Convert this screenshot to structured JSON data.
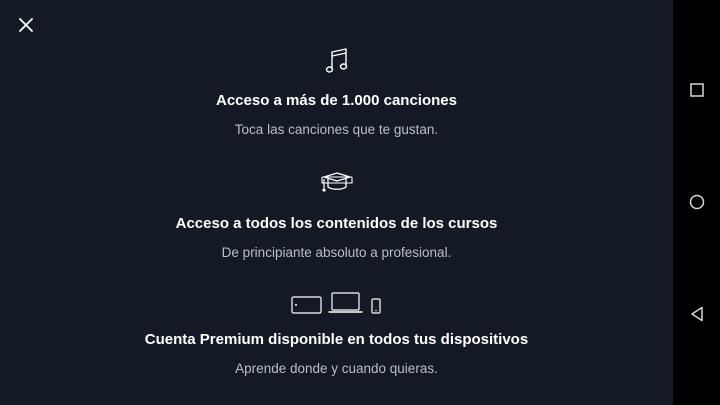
{
  "close": {
    "icon": "close-icon"
  },
  "features": [
    {
      "icon": "music-note-icon",
      "title": "Acceso a más de 1.000 canciones",
      "subtitle": "Toca las canciones que te gustan."
    },
    {
      "icon": "graduation-cap-icon",
      "title": "Acceso a todos los contenidos de los cursos",
      "subtitle": "De principiante absoluto a profesional."
    },
    {
      "icon": "devices-icon",
      "title": "Cuenta Premium disponible en todos tus dispositivos",
      "subtitle": "Aprende donde y cuando quieras."
    }
  ],
  "navbar": {
    "recents": "recents-square-icon",
    "home": "home-circle-icon",
    "back": "back-triangle-icon"
  },
  "colors": {
    "background": "#141a25",
    "title": "#ffffff",
    "subtitle": "#b9bec8",
    "navbar": "#000000"
  }
}
